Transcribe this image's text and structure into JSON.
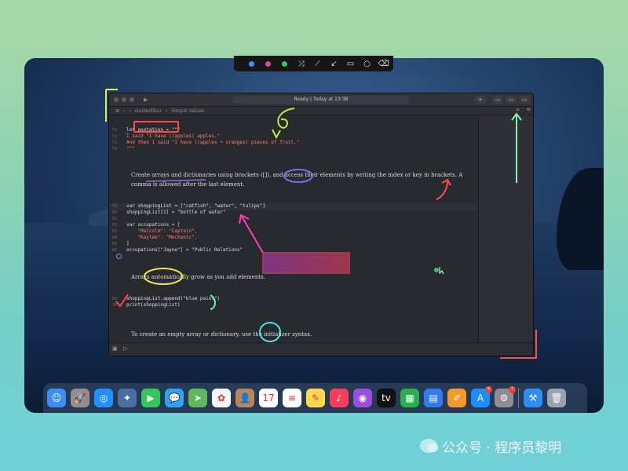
{
  "toolbar": {
    "colors": [
      "#3d8ff2",
      "#ec3fa0",
      "#35c759"
    ],
    "icons": [
      "blue-color-swatch",
      "pink-color-swatch",
      "green-color-swatch",
      "shuffle-icon",
      "pen-icon",
      "arrow-icon",
      "rectangle-icon",
      "circle-icon",
      "eraser-icon"
    ]
  },
  "window": {
    "status": "Ready | Today at 13:38",
    "breadcrumb": [
      "GuidedTour",
      "Simple Values"
    ]
  },
  "code": {
    "block1": [
      {
        "n": "51",
        "text": "let quotation = \"\"\""
      },
      {
        "n": "52",
        "text": "I said \"I have \\(apples) apples.\""
      },
      {
        "n": "53",
        "text": "And then I said \"I have \\(apples + oranges) pieces of fruit.\""
      },
      {
        "n": "54",
        "text": "\"\"\""
      }
    ],
    "prose1a": "Create arrays and dictionaries using brackets ([]), and access their elements by writing the index or key in brackets. A comma is allowed after the",
    "prose1b": "last element.",
    "block2": [
      {
        "n": "59",
        "text": "var shoppingList = [\"catfish\", \"water\", \"tulips\"]"
      },
      {
        "n": "60",
        "text": "shoppingList[1] = \"bottle of water\""
      },
      {
        "n": "61",
        "text": ""
      },
      {
        "n": "62",
        "text": "var occupations = ["
      },
      {
        "n": "63",
        "text": "    \"Malcolm\": \"Captain\","
      },
      {
        "n": "64",
        "text": "    \"Kaylee\": \"Mechanic\","
      },
      {
        "n": "65",
        "text": "]"
      },
      {
        "n": "66",
        "text": "occupations[\"Jayne\"] = \"Public Relations\""
      }
    ],
    "prose2": "Arrays automatically grow as you add elements.",
    "block3": [
      {
        "n": "69",
        "text": "shoppingList.append(\"blue paint\")"
      },
      {
        "n": "70",
        "text": "print(shoppingList)"
      }
    ],
    "prose3": "To create an empty array or dictionary, use the initializer syntax."
  },
  "dock": {
    "apps": [
      {
        "name": "finder",
        "color": "#3a8ef6",
        "glyph": "☺"
      },
      {
        "name": "launchpad",
        "color": "#8e8e93",
        "glyph": "🚀"
      },
      {
        "name": "safari",
        "color": "#1e90ff",
        "glyph": "◎"
      },
      {
        "name": "photo-editor",
        "color": "#4a6fa5",
        "glyph": "✦"
      },
      {
        "name": "facetime",
        "color": "#34c759",
        "glyph": "▶"
      },
      {
        "name": "messages",
        "color": "#30a2f5",
        "glyph": "💬"
      },
      {
        "name": "maps",
        "color": "#5fb85c",
        "glyph": "➤"
      },
      {
        "name": "photos",
        "color": "#f5f5f5",
        "glyph": "✿"
      },
      {
        "name": "contacts",
        "color": "#b7865a",
        "glyph": "👤"
      },
      {
        "name": "calendar",
        "color": "#ffffff",
        "glyph": "17"
      },
      {
        "name": "reminders",
        "color": "#ffffff",
        "glyph": "≡"
      },
      {
        "name": "notes",
        "color": "#ffd84d",
        "glyph": "✎"
      },
      {
        "name": "music",
        "color": "#fb3c5a",
        "glyph": "♪"
      },
      {
        "name": "podcasts",
        "color": "#9b4de0",
        "glyph": "◉"
      },
      {
        "name": "apple-tv",
        "color": "#111111",
        "glyph": "tv"
      },
      {
        "name": "numbers",
        "color": "#28b04e",
        "glyph": "▦"
      },
      {
        "name": "keynote",
        "color": "#2f7bf5",
        "glyph": "▤"
      },
      {
        "name": "pages",
        "color": "#f49a2a",
        "glyph": "✐"
      },
      {
        "name": "app-store",
        "color": "#1c8ef9",
        "glyph": "A",
        "badge": "9"
      },
      {
        "name": "system-preferences",
        "color": "#8e8e93",
        "glyph": "⚙",
        "badge": "1"
      },
      {
        "name": "xcode",
        "color": "#2f8ef5",
        "glyph": "⚒"
      },
      {
        "name": "trash",
        "color": "#9aa3ad",
        "glyph": "🗑"
      }
    ]
  },
  "watermark": "公众号 · 程序员黎明"
}
